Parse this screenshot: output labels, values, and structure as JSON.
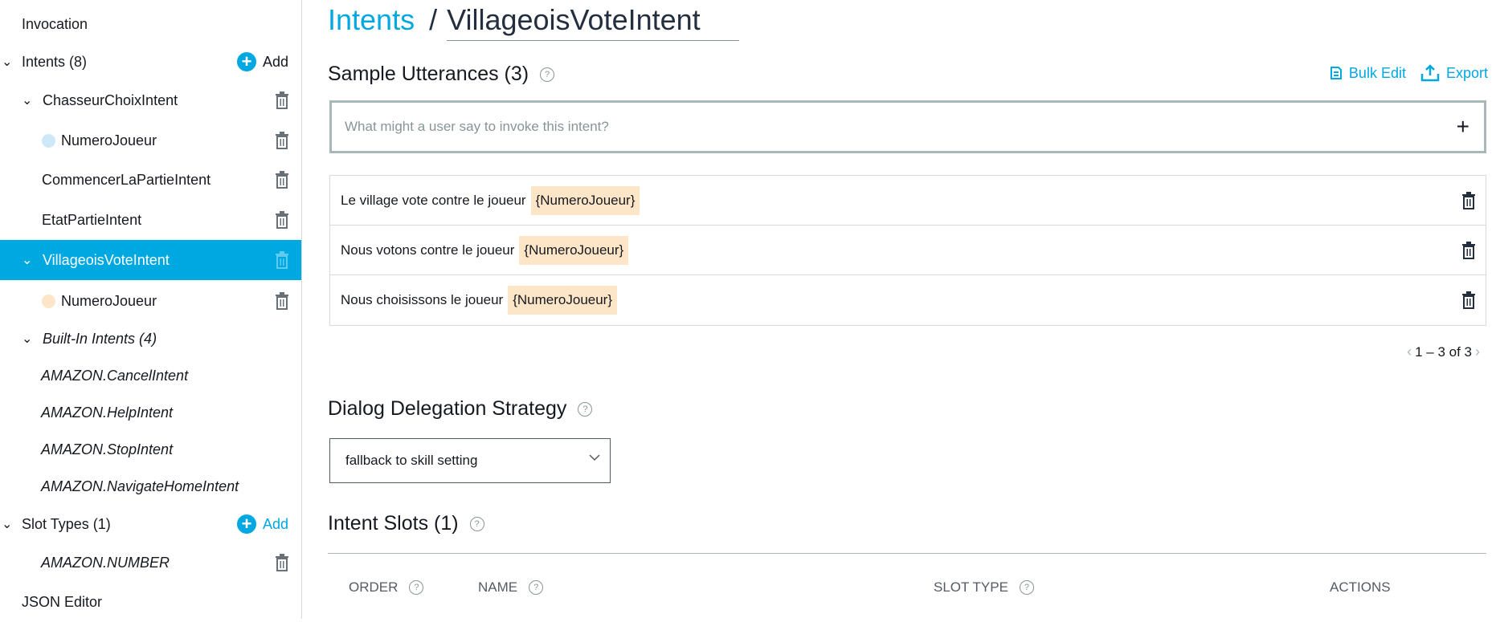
{
  "sidebar": {
    "invocation": "Invocation",
    "intents_header": "Intents (8)",
    "add_label": "Add",
    "intents": [
      {
        "label": "ChasseurChoixIntent"
      },
      {
        "label": "NumeroJoueur"
      },
      {
        "label": "CommencerLaPartieIntent"
      },
      {
        "label": "EtatPartieIntent"
      },
      {
        "label": "VillageoisVoteIntent"
      },
      {
        "label": "NumeroJoueur"
      }
    ],
    "builtin_header": "Built-In Intents (4)",
    "builtins": [
      "AMAZON.CancelIntent",
      "AMAZON.HelpIntent",
      "AMAZON.StopIntent",
      "AMAZON.NavigateHomeIntent"
    ],
    "slot_types_header": "Slot Types (1)",
    "slot_types": [
      "AMAZON.NUMBER"
    ],
    "json_editor": "JSON Editor"
  },
  "main": {
    "breadcrumb_link": "Intents",
    "breadcrumb_sep": "/",
    "intent_name": "VillageoisVoteIntent",
    "sample_title": "Sample Utterances (3)",
    "bulk_edit": "Bulk Edit",
    "export": "Export",
    "utterance_placeholder": "What might a user say to invoke this intent?",
    "utterances": [
      {
        "text": "Le village vote contre le joueur",
        "slot": "{NumeroJoueur}"
      },
      {
        "text": "Nous votons contre le joueur",
        "slot": "{NumeroJoueur}"
      },
      {
        "text": "Nous choisissons le joueur",
        "slot": "{NumeroJoueur}"
      }
    ],
    "pagination": "1 – 3 of 3",
    "dialog_title": "Dialog Delegation Strategy",
    "dialog_select": "fallback to skill setting",
    "slots_title": "Intent Slots (1)",
    "columns": {
      "order": "ORDER",
      "name": "NAME",
      "slot_type": "SLOT TYPE",
      "actions": "ACTIONS"
    },
    "help_glyph": "?"
  },
  "colors": {
    "accent": "#00a8e1",
    "slot_chip": "#fde6c8",
    "slot_dot_1": "#cde9f8",
    "slot_dot_2": "#fde6c8"
  }
}
